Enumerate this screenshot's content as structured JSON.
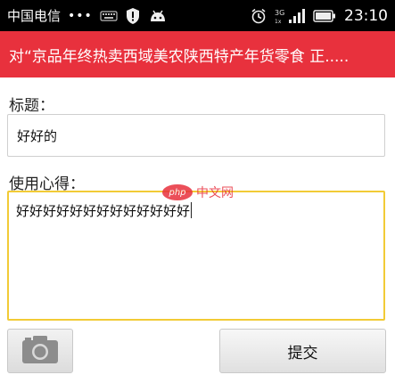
{
  "status_bar": {
    "carrier": "中国电信",
    "dots": "•••",
    "time": "23:10",
    "network_label": "3G",
    "icons": [
      "keyboard-icon",
      "shield-icon",
      "android-icon",
      "alarm-icon",
      "signal-icon",
      "battery-icon"
    ]
  },
  "header": {
    "title": "对“京品年终热卖西域美农陕西特产年货零食 正....."
  },
  "form": {
    "title_label": "标题：",
    "title_value": "好好的",
    "experience_label": "使用心得：",
    "experience_value": "好好好好好好好好好好好好好"
  },
  "watermark": {
    "logo": "php",
    "text": "中文网"
  },
  "actions": {
    "camera_icon": "camera-icon",
    "submit_label": "提交"
  },
  "colors": {
    "header_bg": "#e8313d",
    "focus_border": "#f2cb36"
  }
}
